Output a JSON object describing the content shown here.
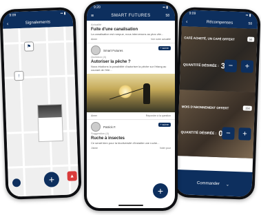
{
  "left_phone": {
    "time": "9:09",
    "title": "Signalements",
    "fab_label": "+"
  },
  "center_phone": {
    "time": "9:20",
    "logo_text": "SMART FUTURES",
    "points": "58",
    "posts": [
      {
        "label": "Actualité",
        "title": "Fuite d'une canalisation",
        "text": "La canalisation est rompue, nous intervenons au plus vite...",
        "like": "Aimer",
        "share": "Voir notre actualité"
      },
      {
        "author": "Smart Futures",
        "badge": "+ suivre",
        "label": "Question (4)",
        "title": "Autoriser la pêche ?",
        "text": "Nous étudions la possibilité d'autoriser la pêche sur l'étang au courant de l'été...",
        "like": "Aimer",
        "share": "Répondre à la question"
      },
      {
        "author": "Patrick F.",
        "badge": "+ suivre",
        "label": "Suggestion (4)",
        "title": "Ruche à insectes",
        "text": "Ce serait bien pour la biodiversité d'installer une ruche...",
        "like": "J'aime",
        "share": "Voter pour"
      }
    ],
    "fab_label": "+"
  },
  "right_phone": {
    "time": "9:09",
    "title": "Récompenses",
    "points": "58",
    "rewards": [
      {
        "title": "CAFÉ ACHETÉ, UN CAFÉ OFFERT",
        "points": "50",
        "qty_label": "QUANTITÉ DÉSIRÉE :",
        "qty": "3"
      },
      {
        "title": "MOIS D'ABONNEMENT OFFERT",
        "points": "150",
        "qty_label": "QUANTITÉ DÉSIRÉE :",
        "qty": "0"
      }
    ],
    "order_label": "Commander"
  },
  "colors": {
    "brand_navy": "#0d2f5e"
  }
}
